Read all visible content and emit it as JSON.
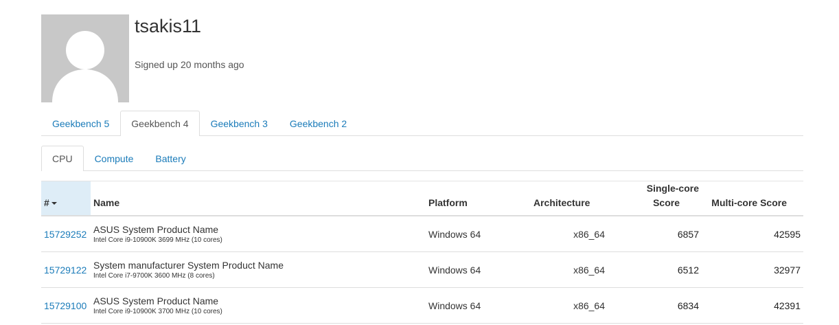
{
  "profile": {
    "username": "tsakis11",
    "signed_up": "Signed up 20 months ago"
  },
  "benchmark_tabs": [
    {
      "label": "Geekbench 5",
      "active": false
    },
    {
      "label": "Geekbench 4",
      "active": true
    },
    {
      "label": "Geekbench 3",
      "active": false
    },
    {
      "label": "Geekbench 2",
      "active": false
    }
  ],
  "category_tabs": [
    {
      "label": "CPU",
      "active": true
    },
    {
      "label": "Compute",
      "active": false
    },
    {
      "label": "Battery",
      "active": false
    }
  ],
  "table": {
    "headers": {
      "id": "#",
      "name": "Name",
      "platform": "Platform",
      "architecture": "Architecture",
      "single_core_line1": "Single-core",
      "single_core_line2": "Score",
      "multi_core": "Multi-core Score"
    },
    "rows": [
      {
        "id": "15729252",
        "system": "ASUS System Product Name",
        "cpu": "Intel Core i9-10900K 3699 MHz (10 cores)",
        "platform": "Windows 64",
        "architecture": "x86_64",
        "single_core": "6857",
        "multi_core": "42595"
      },
      {
        "id": "15729122",
        "system": "System manufacturer System Product Name",
        "cpu": "Intel Core i7-9700K 3600 MHz (8 cores)",
        "platform": "Windows 64",
        "architecture": "x86_64",
        "single_core": "6512",
        "multi_core": "32977"
      },
      {
        "id": "15729100",
        "system": "ASUS System Product Name",
        "cpu": "Intel Core i9-10900K 3700 MHz (10 cores)",
        "platform": "Windows 64",
        "architecture": "x86_64",
        "single_core": "6834",
        "multi_core": "42391"
      }
    ]
  },
  "colors": {
    "link": "#1a7bb9",
    "avatar_bg": "#c8c8c8",
    "sorted_header_bg": "#deedf7"
  }
}
